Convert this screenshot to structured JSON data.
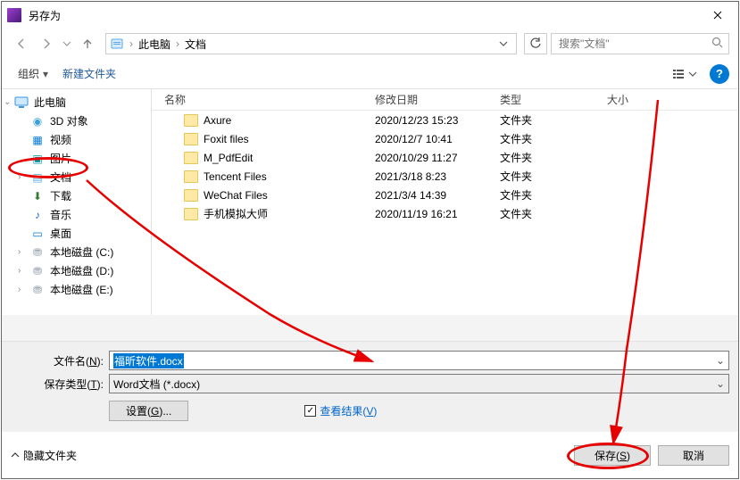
{
  "titlebar": {
    "title": "另存为"
  },
  "breadcrumbs": {
    "root": "此电脑",
    "sub": "文档"
  },
  "search": {
    "placeholder": "搜索\"文档\""
  },
  "toolbar": {
    "organize": "组织",
    "newfolder": "新建文件夹"
  },
  "columns": {
    "name": "名称",
    "date": "修改日期",
    "type": "类型",
    "size": "大小"
  },
  "tree": {
    "root": "此电脑",
    "items": [
      {
        "label": "3D 对象",
        "iconClass": "ico-3d",
        "glyph": "◉"
      },
      {
        "label": "视频",
        "iconClass": "ico-video",
        "glyph": "▦"
      },
      {
        "label": "图片",
        "iconClass": "ico-pic",
        "glyph": "▣"
      },
      {
        "label": "文档",
        "iconClass": "ico-doc",
        "glyph": "▤",
        "selected": true,
        "expand": true
      },
      {
        "label": "下载",
        "iconClass": "ico-dl",
        "glyph": "⬇"
      },
      {
        "label": "音乐",
        "iconClass": "ico-music",
        "glyph": "♪"
      },
      {
        "label": "桌面",
        "iconClass": "ico-desktop",
        "glyph": "▭"
      },
      {
        "label": "本地磁盘 (C:)",
        "iconClass": "ico-disk",
        "glyph": "⛃",
        "expand": true
      },
      {
        "label": "本地磁盘 (D:)",
        "iconClass": "ico-disk",
        "glyph": "⛃",
        "expand": true
      },
      {
        "label": "本地磁盘 (E:)",
        "iconClass": "ico-disk",
        "glyph": "⛃",
        "expand": true
      }
    ]
  },
  "files": [
    {
      "name": "Axure",
      "date": "2020/12/23 15:23",
      "type": "文件夹"
    },
    {
      "name": "Foxit files",
      "date": "2020/12/7 10:41",
      "type": "文件夹"
    },
    {
      "name": "M_PdfEdit",
      "date": "2020/10/29 11:27",
      "type": "文件夹"
    },
    {
      "name": "Tencent Files",
      "date": "2021/3/18 8:23",
      "type": "文件夹"
    },
    {
      "name": "WeChat Files",
      "date": "2021/3/4 14:39",
      "type": "文件夹"
    },
    {
      "name": "手机模拟大师",
      "date": "2020/11/19 16:21",
      "type": "文件夹"
    }
  ],
  "bottom": {
    "filename_label": "文件名(N):",
    "filename_value": "福昕软件.docx",
    "type_label": "保存类型(T):",
    "type_value": "Word文档 (*.docx)",
    "settings_btn": "设置(G)...",
    "view_results": "查看结果(V)"
  },
  "footer": {
    "hide_folders": "隐藏文件夹",
    "save": "保存(S)",
    "cancel": "取消"
  }
}
